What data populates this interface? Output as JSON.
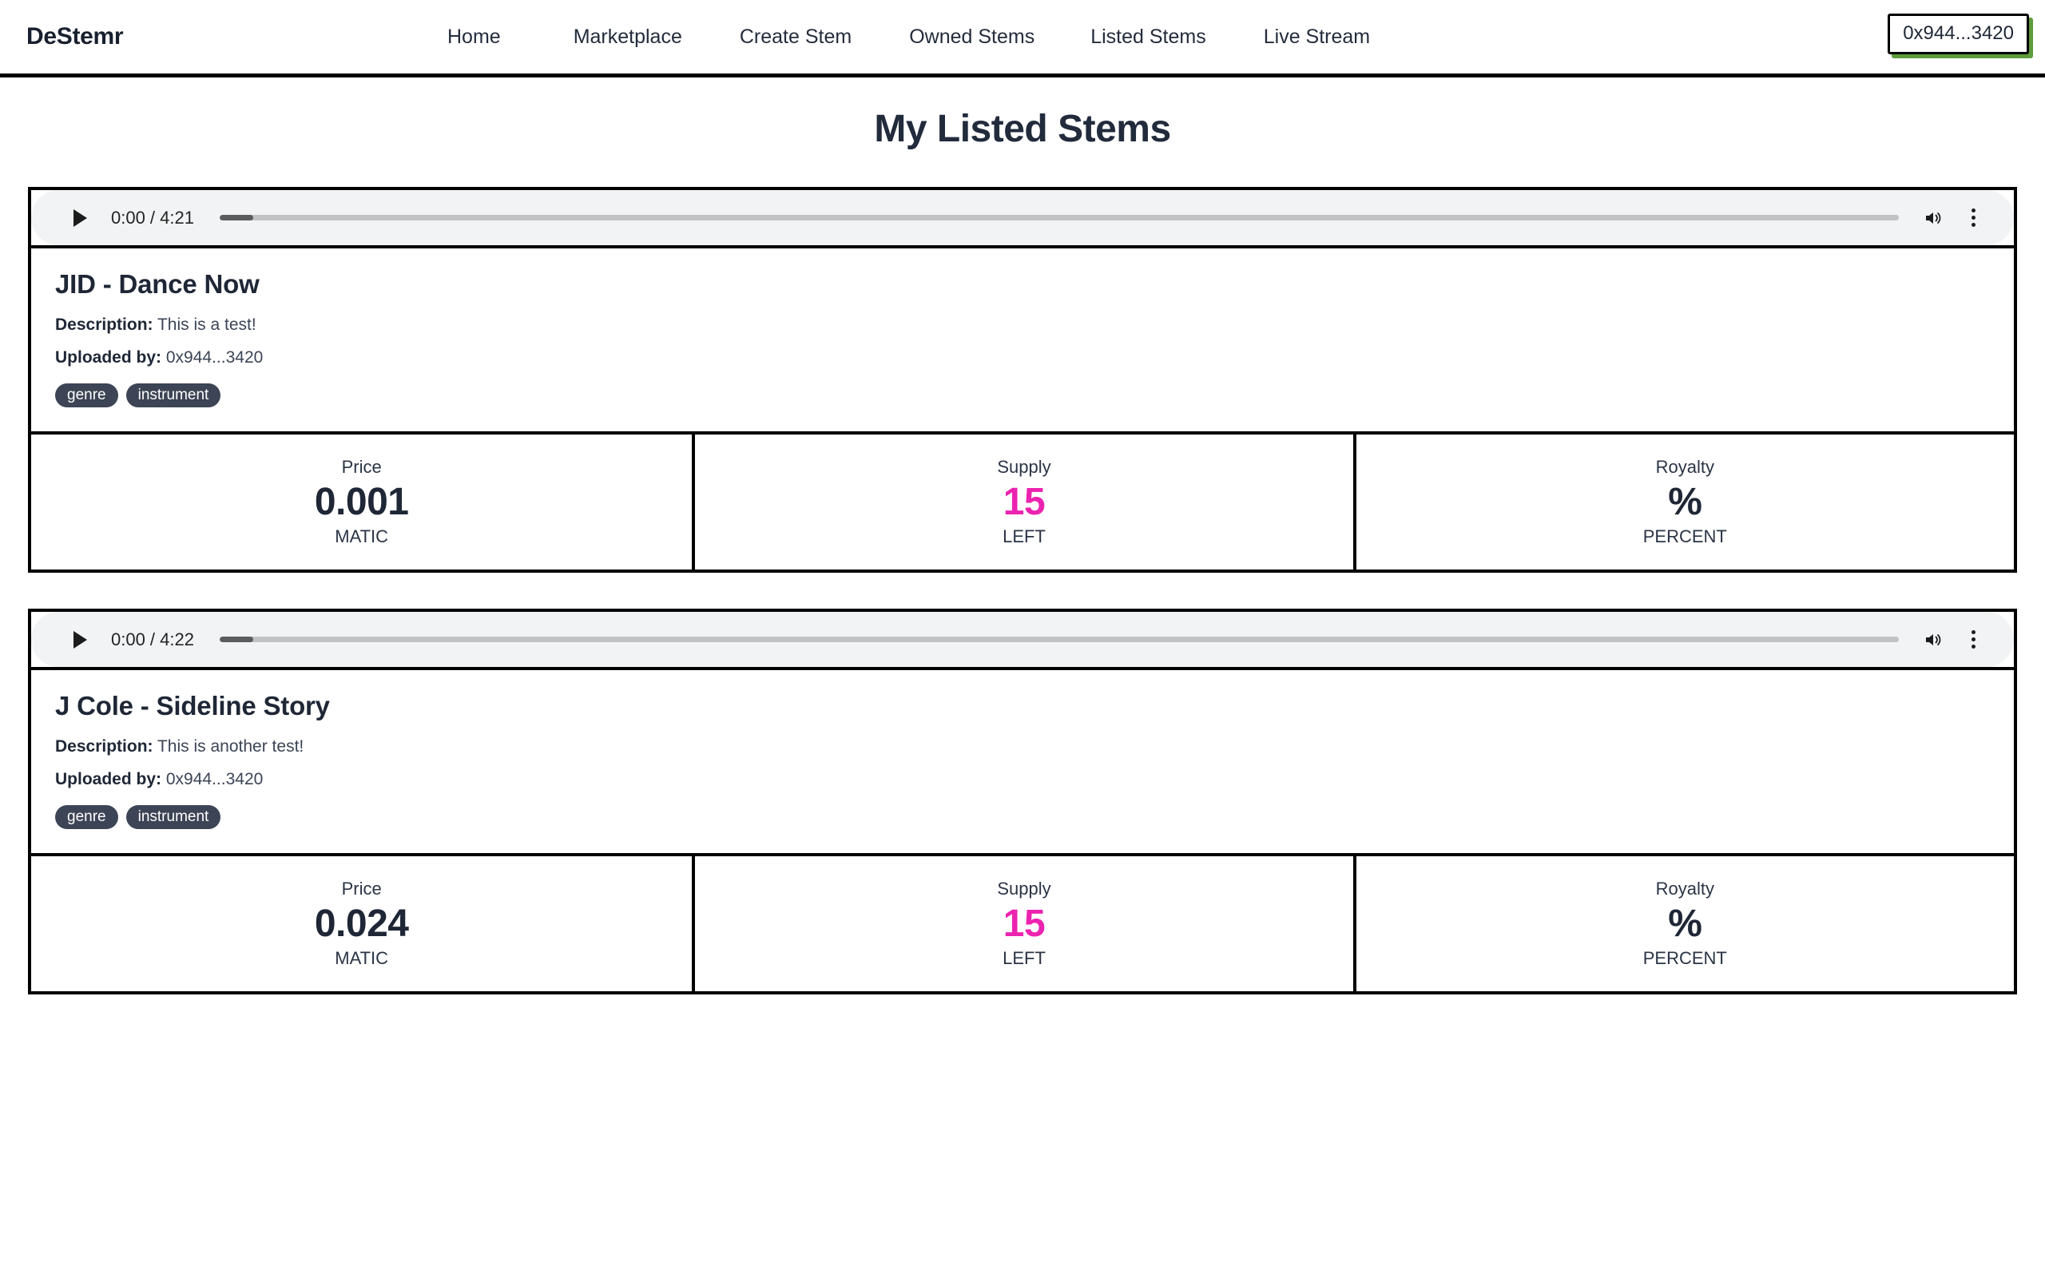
{
  "header": {
    "brand": "DeStemr",
    "nav": [
      {
        "label": "Home"
      },
      {
        "label": "Marketplace"
      },
      {
        "label": "Create Stem"
      },
      {
        "label": "Owned Stems"
      },
      {
        "label": "Listed Stems"
      },
      {
        "label": "Live Stream"
      }
    ],
    "wallet_label": "0x944...3420",
    "wallet_shadow_color": "#5e9b3a",
    "border_color": "#000000"
  },
  "page": {
    "title": "My Listed Stems"
  },
  "labels": {
    "description_label": "Description:",
    "uploaded_by_label": "Uploaded by:",
    "price_label": "Price",
    "supply_label": "Supply",
    "royalty_label": "Royalty",
    "price_unit": "MATIC",
    "supply_unit": "LEFT",
    "royalty_unit": "PERCENT"
  },
  "colors": {
    "supply_accent": "#ec23b0",
    "tag_background": "#3c4455",
    "title_text": "#1f2736"
  },
  "icons": {
    "play": "play-icon",
    "volume": "volume-icon",
    "overflow_menu": "three-dot-menu-icon"
  },
  "stems": [
    {
      "player": {
        "time": "0:00 / 4:21",
        "current_time": "0:00",
        "duration": "4:21",
        "progress_percent": 2
      },
      "title": "JID - Dance Now",
      "description": "This is a test!",
      "uploaded_by": "0x944...3420",
      "tags": [
        "genre",
        "instrument"
      ],
      "price": "0.001",
      "supply": "15",
      "royalty": "%"
    },
    {
      "player": {
        "time": "0:00 / 4:22",
        "current_time": "0:00",
        "duration": "4:22",
        "progress_percent": 2
      },
      "title": "J Cole - Sideline Story",
      "description": "This is another test!",
      "uploaded_by": "0x944...3420",
      "tags": [
        "genre",
        "instrument"
      ],
      "price": "0.024",
      "supply": "15",
      "royalty": "%"
    }
  ]
}
